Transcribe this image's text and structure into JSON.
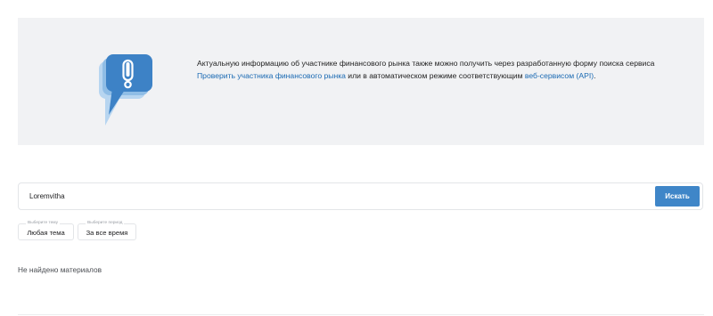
{
  "info_banner": {
    "text_before": "Актуальную информацию об участнике финансового рынка также можно получить через разработанную форму поиска сервиса ",
    "link_check": "Проверить участника финансового рынка",
    "text_middle": " или в автоматическом режиме соответствующим ",
    "link_api": "веб-сервисом (API)",
    "text_after": ".",
    "icon": "exclamation-speech-bubble-icon",
    "colors": {
      "bubble_front": "#3d82c6",
      "bubble_back": "#9cc6ea",
      "link": "#1b6ab3"
    }
  },
  "search": {
    "value": "Loremvitha",
    "placeholder": "",
    "button_label": "Искать",
    "button_color": "#3f86c8"
  },
  "filters": [
    {
      "legend": "Выберите тему",
      "value": "Любая тема"
    },
    {
      "legend": "Выберите период",
      "value": "За все время"
    }
  ],
  "results": {
    "empty_message": "Не найдено материалов"
  }
}
